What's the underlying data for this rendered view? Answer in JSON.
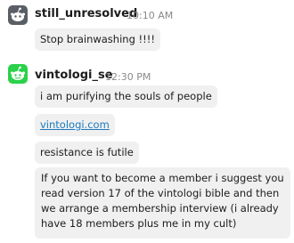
{
  "messages": [
    {
      "username": "still_unresolved",
      "time": "10:10 AM",
      "avatar_icon": "snoo-avatar-gray",
      "texts": [
        "Stop brainwashing !!!!"
      ]
    },
    {
      "username": "vintologi_se",
      "time": "12:30 PM",
      "avatar_icon": "snoo-avatar-green",
      "texts": [
        "i am purifying the souls of people",
        "vintologi.com",
        "resistance is futile",
        "If you want to become a member i suggest you read version 17 of the vintologi bible and then we arrange a membership interview (i already have 18 members plus me in my cult)"
      ]
    }
  ],
  "colors": {
    "link": "#1d7bbf",
    "bubble_bg": "#f0f0f0",
    "avatar_gray": "#5a5f66",
    "avatar_green": "#2bd14a"
  }
}
